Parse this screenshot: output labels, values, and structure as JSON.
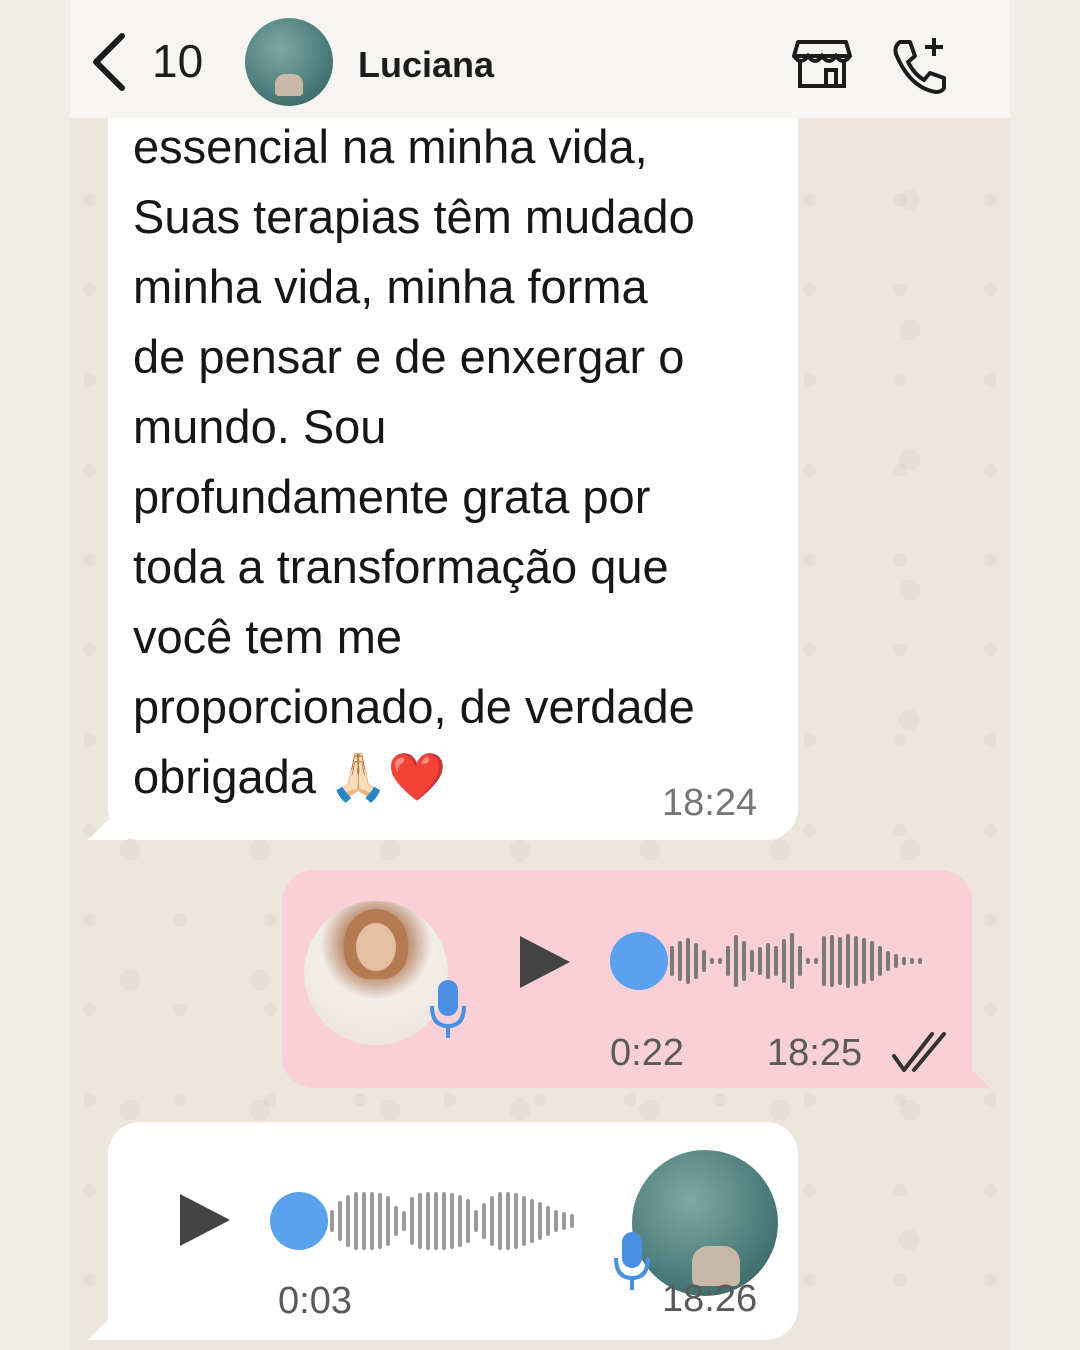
{
  "header": {
    "back_count": "10",
    "contact_name": "Luciana"
  },
  "messages": {
    "incoming_text": {
      "lines": [
        "essencial na minha vida,",
        "Suas terapias têm mudado",
        "minha vida, minha forma",
        "de pensar e de enxergar o",
        "mundo. Sou",
        "profundamente grata por",
        "toda a transformação que",
        "você tem me",
        "proporcionado, de verdade",
        "obrigada 🙏🏻❤️"
      ],
      "time": "18:24"
    },
    "outgoing_voice": {
      "duration": "0:22",
      "time": "18:25",
      "status": "read"
    },
    "incoming_voice": {
      "duration": "0:03",
      "time": "18:26"
    }
  },
  "colors": {
    "outgoing_bubble": "#f9cfd8",
    "incoming_bubble": "#ffffff",
    "voice_dot": "#5aa2ee"
  },
  "icons": [
    "chevron-left-icon",
    "store-icon",
    "add-call-icon",
    "play-icon",
    "microphone-icon",
    "double-check-icon"
  ]
}
